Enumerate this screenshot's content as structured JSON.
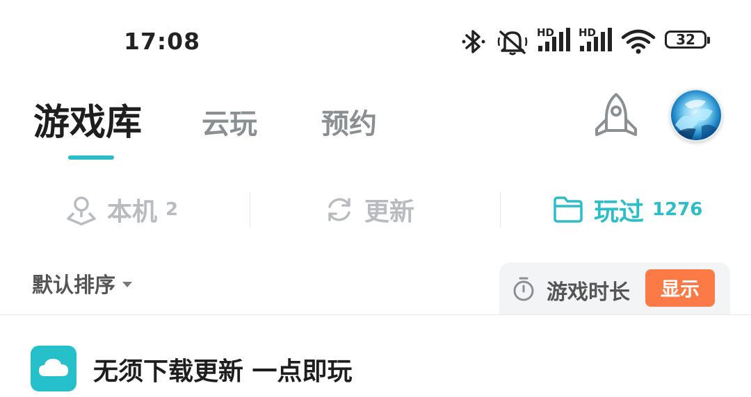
{
  "status_bar": {
    "time": "17:08",
    "signal_1_label": "HD",
    "signal_2_label": "HD",
    "battery_level": "32",
    "icons": [
      "bluetooth-icon",
      "mute-icon",
      "signal-icon",
      "signal-icon",
      "wifi-icon",
      "battery-icon"
    ]
  },
  "top_tabs": {
    "library": "游戏库",
    "cloud": "云玩",
    "reserve": "预约",
    "active": "library"
  },
  "header_icons": [
    "rocket-icon",
    "avatar"
  ],
  "sub_tabs": {
    "local": {
      "label": "本机",
      "count": "2"
    },
    "update": {
      "label": "更新"
    },
    "played": {
      "label": "玩过",
      "count": "1276"
    },
    "active": "played"
  },
  "sort": {
    "label": "默认排序"
  },
  "duration": {
    "label": "游戏时长",
    "button": "显示"
  },
  "banner": {
    "text": "无须下载更新 一点即玩"
  },
  "colors": {
    "accent": "#2bbec8",
    "orange_button": "#fb7a45",
    "muted": "#b8bcc0",
    "cloud_icon_bg": "#25c0c9"
  }
}
